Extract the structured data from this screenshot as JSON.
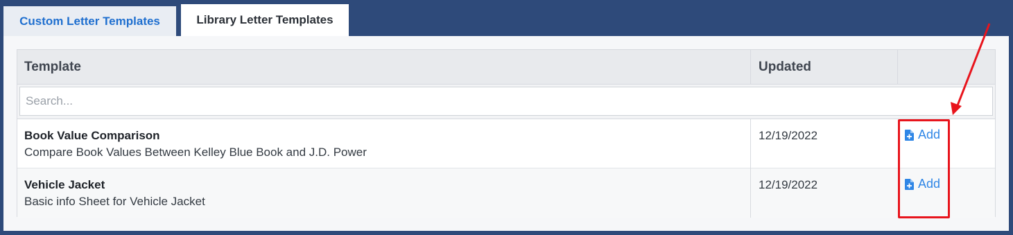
{
  "tabs": [
    {
      "label": "Custom Letter Templates",
      "active": false
    },
    {
      "label": "Library Letter Templates",
      "active": true
    }
  ],
  "table": {
    "columns": [
      "Template",
      "Updated",
      ""
    ],
    "search_placeholder": "Search...",
    "rows": [
      {
        "name": "Book Value Comparison",
        "description": "Compare Book Values Between Kelley Blue Book and J.D. Power",
        "updated": "12/19/2022",
        "action": "Add"
      },
      {
        "name": "Vehicle Jacket",
        "description": "Basic info Sheet for Vehicle Jacket",
        "updated": "12/19/2022",
        "action": "Add"
      }
    ]
  },
  "annotation": {
    "color": "#e8141c"
  },
  "colors": {
    "background": "#2e4a7a",
    "link": "#2f86e6",
    "active_tab_text": "#1f6fcf"
  }
}
